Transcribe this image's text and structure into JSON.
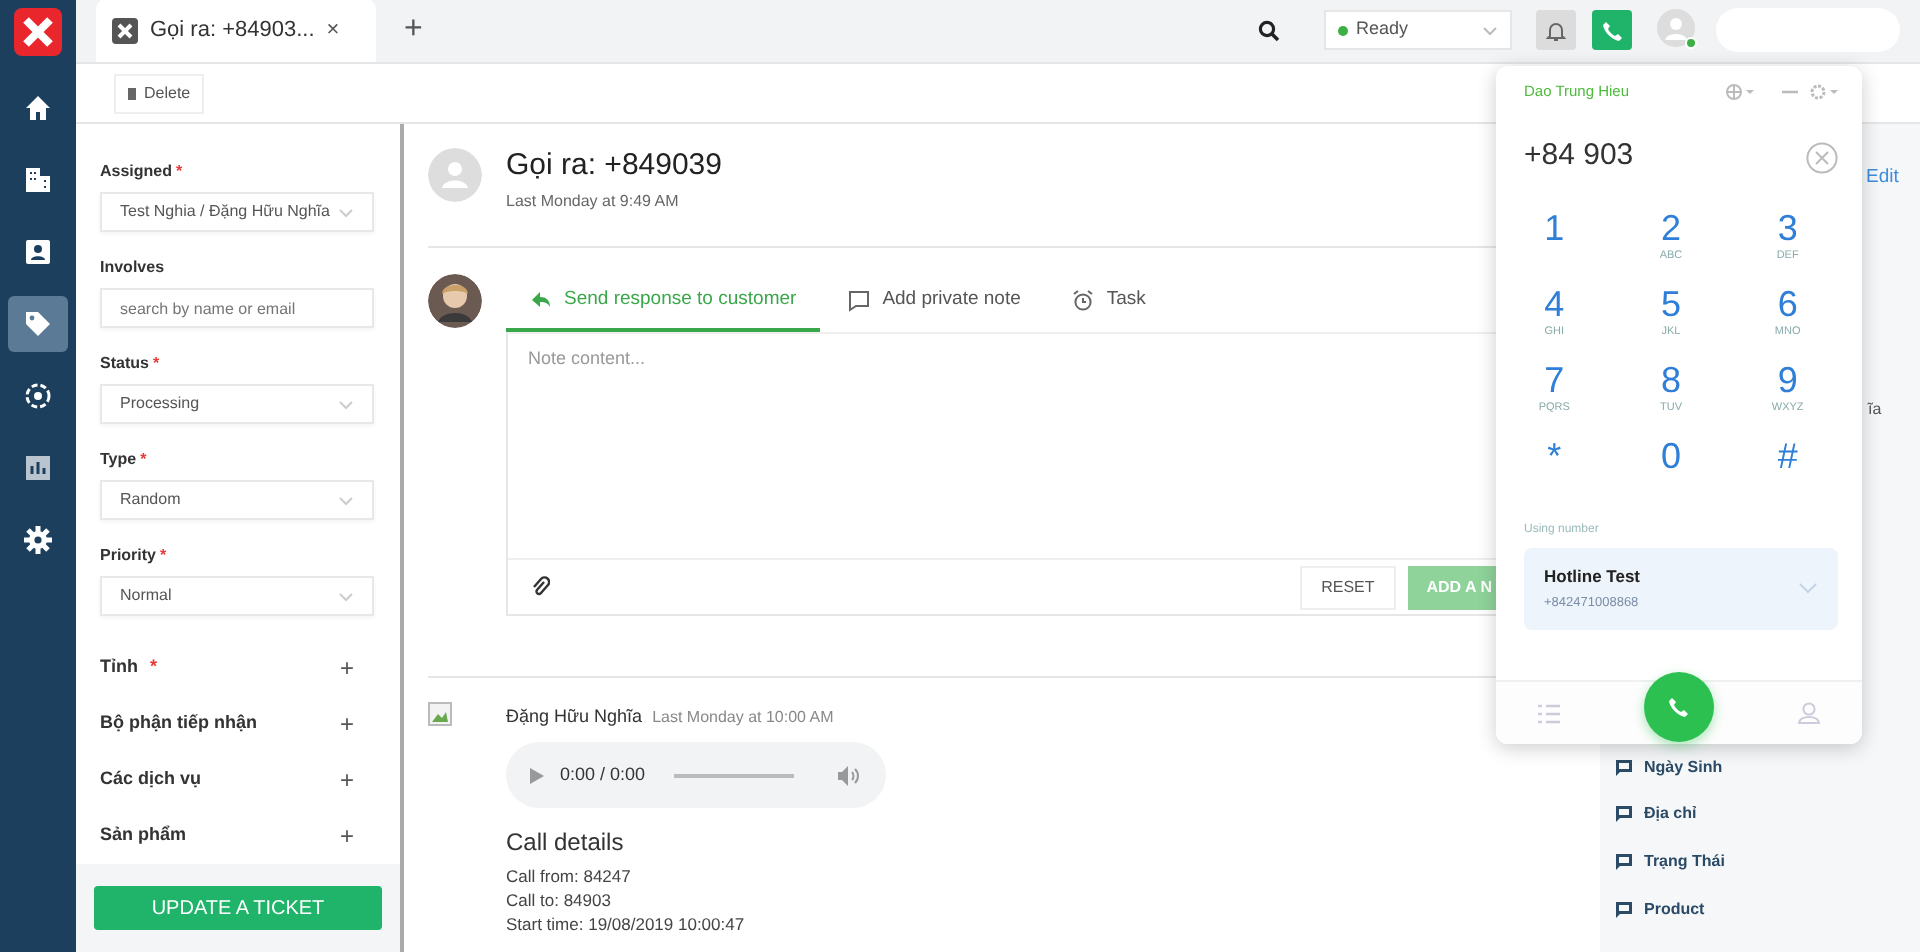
{
  "nav": [
    {
      "kind": "home",
      "selected": false
    },
    {
      "kind": "building",
      "selected": false
    },
    {
      "kind": "contact",
      "selected": false
    },
    {
      "kind": "tag",
      "selected": true
    },
    {
      "kind": "target",
      "selected": false
    },
    {
      "kind": "chart",
      "selected": false
    },
    {
      "kind": "gear",
      "selected": false
    }
  ],
  "browser_tabs": [
    {
      "title": "Gọi ra: +84903...",
      "close": "×",
      "selected": true
    }
  ],
  "new_tab": "+",
  "header": {
    "agent_status": {
      "value": "Ready",
      "color": "#3cb043"
    },
    "calling": true
  },
  "toolbar": {
    "delete": "Delete"
  },
  "form": {
    "fields": [
      {
        "label": "Assigned",
        "mark": "*",
        "kind": "select",
        "value": "Test Nghia / Đặng Hữu Nghĩa"
      },
      {
        "label": "Involves",
        "kind": "input",
        "placeholder": "search by name or email"
      },
      {
        "label": "Status",
        "mark": "*",
        "kind": "select",
        "value": "Processing"
      },
      {
        "label": "Type",
        "mark": "*",
        "kind": "select",
        "value": "Random"
      },
      {
        "label": "Priority",
        "mark": "*",
        "kind": "select",
        "value": "Normal"
      }
    ],
    "sections": [
      {
        "label": "Tỉnh",
        "mark": "*",
        "toggle": "+"
      },
      {
        "label": "Bộ phận tiếp nhận",
        "toggle": "+"
      },
      {
        "label": "Các dịch vụ",
        "toggle": "+"
      },
      {
        "label": "Sản phẩm",
        "toggle": "+"
      }
    ],
    "submit": "UPDATE A TICKET"
  },
  "ticket": {
    "title": "Gọi ra: +849039",
    "time": "Last Monday at 9:49 AM"
  },
  "composer": {
    "tabs": [
      {
        "label": "Send response to customer",
        "kind": "reply",
        "selected": true
      },
      {
        "label": "Add private note",
        "kind": "note",
        "selected": false
      },
      {
        "label": "Task",
        "kind": "alarm",
        "selected": false
      }
    ],
    "placeholder": "Note content...",
    "reset": "RESET",
    "submit": "ADD A N"
  },
  "activity": {
    "author": "Đặng Hữu Nghĩa",
    "time": "Last Monday at 10:00 AM",
    "player_time": "0:00 / 0:00",
    "heading": "Call details",
    "lines": [
      "Call from: 84247",
      "Call to: 84903",
      "Start time: 19/08/2019 10:00:47"
    ]
  },
  "side": {
    "edit": "Edit",
    "fragments": [
      "ĩa"
    ],
    "fields": [
      "Ngày Sinh",
      "Địa chỉ",
      "Trạng Thái",
      "Product"
    ]
  },
  "dialer": {
    "agent": "Dao Trung Hieu",
    "number": "+84 903",
    "keys": [
      {
        "digit": "1"
      },
      {
        "digit": "2",
        "letters": "ABC"
      },
      {
        "digit": "3",
        "letters": "DEF"
      },
      {
        "digit": "4",
        "letters": "GHI"
      },
      {
        "digit": "5",
        "letters": "JKL"
      },
      {
        "digit": "6",
        "letters": "MNO"
      },
      {
        "digit": "7",
        "letters": "PQRS"
      },
      {
        "digit": "8",
        "letters": "TUV"
      },
      {
        "digit": "9",
        "letters": "WXYZ"
      },
      {
        "digit": "*"
      },
      {
        "digit": "0"
      },
      {
        "digit": "#"
      }
    ],
    "using_label": "Using number",
    "line": {
      "name": "Hotline Test",
      "number": "+842471008868"
    }
  }
}
